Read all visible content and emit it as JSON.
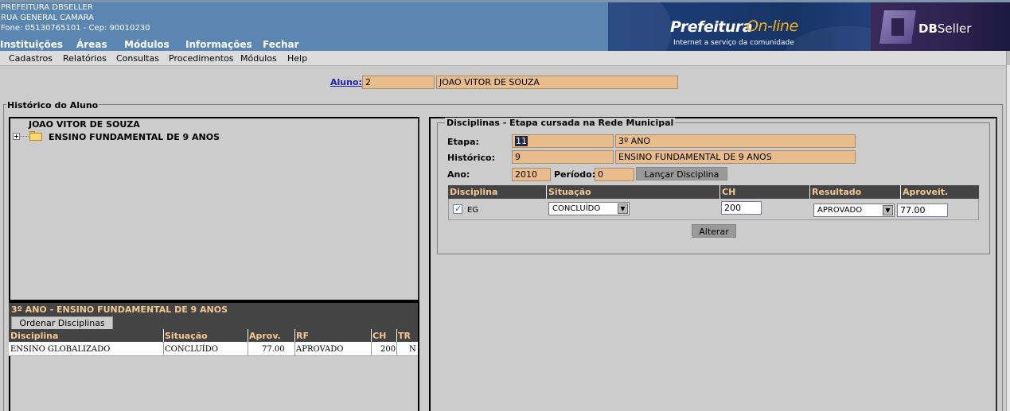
{
  "header": {
    "org_name": "PREFEITURA DBSELLER",
    "address": "RUA GENERAL CAMARA",
    "contact": "Fone: 05130765101  -  Cep: 90010230",
    "main_menu": [
      "Instituições",
      "Áreas",
      "Módulos",
      "Informações",
      "Fechar"
    ],
    "banner_prefeitura": "Prefeitura",
    "banner_online": "On-line",
    "banner_tagline": "Internet a serviço da comunidade",
    "banner_dbseller_db": "DB",
    "banner_dbseller_seller": "Seller"
  },
  "submenu": [
    "Cadastros",
    "Relatórios",
    "Consultas",
    "Procedimentos",
    "Módulos",
    "Help"
  ],
  "aluno": {
    "label": "Aluno:",
    "code": "2",
    "name": "JOAO VITOR DE SOUZA"
  },
  "historico": {
    "legend": "Histórico do Aluno",
    "tree_root": "JOAO VITOR DE SOUZA",
    "tree_node": "ENSINO FUNDAMENTAL DE 9 ANOS"
  },
  "etapa_panel": {
    "title": "3º ANO - ENSINO FUNDAMENTAL DE 9 ANOS",
    "ordenar_button": "Ordenar Disciplinas",
    "columns": [
      "Disciplina",
      "Situação",
      "Aprov.",
      "RF",
      "CH",
      "TR"
    ],
    "rows": [
      {
        "disciplina": "ENSINO GLOBALIZADO",
        "situacao": "CONCLUÍDO",
        "aprov": "77.00",
        "rf": "APROVADO",
        "ch": "200",
        "tr": "N"
      }
    ]
  },
  "disciplinas": {
    "legend": "Disciplinas - Etapa cursada na Rede Municipal",
    "etapa_label": "Etapa:",
    "etapa_code": "11",
    "etapa_name": "3º ANO",
    "historico_label": "Histórico:",
    "historico_code": "9",
    "historico_name": "ENSINO FUNDAMENTAL DE 9 ANOS",
    "ano_label": "Ano:",
    "ano_value": "2010",
    "periodo_label": "Período:",
    "periodo_value": "0",
    "lancar_button": "Lançar Disciplina",
    "columns": [
      "Disciplina",
      "Situação",
      "CH",
      "Resultado",
      "Aproveit."
    ],
    "row": {
      "checked": true,
      "disciplina": "EG",
      "situacao": "CONCLUÍDO",
      "ch": "200",
      "resultado": "APROVADO",
      "aproveitamento": "77.00"
    },
    "alterar_button": "Alterar"
  },
  "colors": {
    "header_bg": "#5b86b2",
    "input_orange": "#e9bc8c",
    "table_header_bg": "#444444",
    "table_header_text": "#f3c892",
    "page_bg": "#cccccc",
    "link": "#2222aa"
  },
  "icons": [
    "plus-expander-icon",
    "folder-icon",
    "checkbox-checked-icon",
    "dropdown-arrow-icon"
  ]
}
